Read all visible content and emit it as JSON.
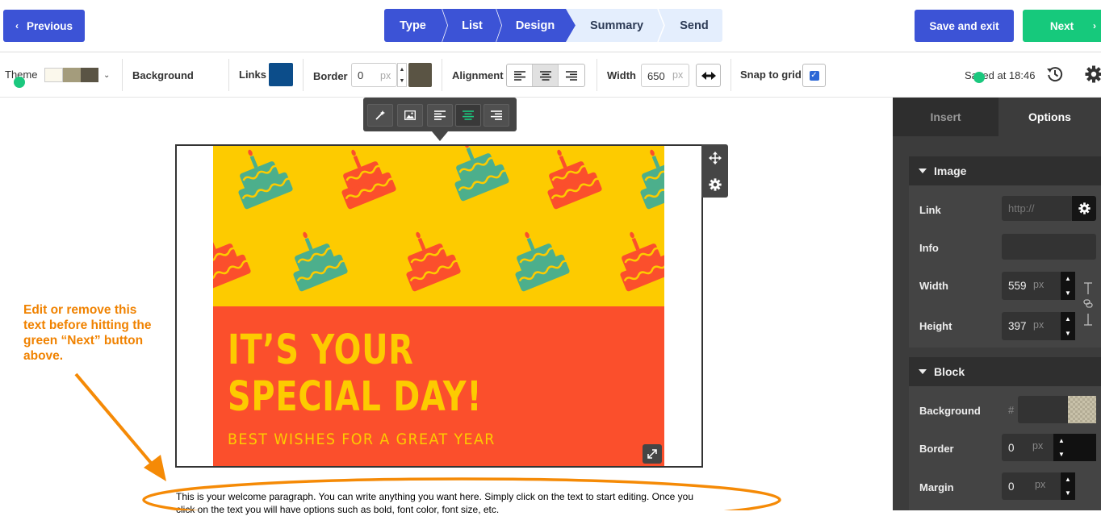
{
  "nav": {
    "previous_label": "Previous",
    "save_exit_label": "Save and exit",
    "next_label": "Next",
    "steps": [
      {
        "label": "Type",
        "state": "done"
      },
      {
        "label": "List",
        "state": "done"
      },
      {
        "label": "Design",
        "state": "done"
      },
      {
        "label": "Summary",
        "state": "todo"
      },
      {
        "label": "Send",
        "state": "todo"
      }
    ],
    "colors": {
      "primary": "#3c53d6",
      "success": "#16c97c",
      "step_pending": "#e4eefd"
    }
  },
  "toolbar": {
    "theme_label": "Theme",
    "theme_colors": [
      "#fbf8ec",
      "#a49c7c",
      "#5a5444"
    ],
    "background_label": "Background",
    "links_label": "Links",
    "links_color": "#0c4d8a",
    "border_label": "Border",
    "border_value": "0",
    "border_unit": "px",
    "border_color": "#5a5444",
    "alignment_label": "Alignment",
    "alignment_selected": "center",
    "width_label": "Width",
    "width_value": "650",
    "width_unit": "px",
    "snap_label": "Snap to grid",
    "snap_checked": true,
    "saved_text": "Saved at 18:46"
  },
  "canvas": {
    "image_toolbar_selected": "align-center",
    "headline": "IT’S YOUR\nSPECIAL DAY!",
    "tagline": "BEST WISHES FOR A GREAT YEAR",
    "art_colors": {
      "yellow": "#fdcb00",
      "red": "#fb4f2c",
      "teal": "#4caf8c"
    },
    "annotation": "Edit or remove this text before hitting the green “Next” button above.",
    "annotation_color": "#f08200",
    "paragraph": "This is your welcome paragraph. You can write anything you want here. Simply click on the text to start editing. Once you click on the text you will have options such as bold, font color, font size, etc."
  },
  "panel": {
    "tabs": [
      {
        "label": "Insert",
        "active": false
      },
      {
        "label": "Options",
        "active": true
      }
    ],
    "image_section": {
      "title": "Image",
      "link_label": "Link",
      "link_placeholder": "http://",
      "info_label": "Info",
      "width_label": "Width",
      "width_value": "559",
      "height_label": "Height",
      "height_value": "397",
      "unit": "px"
    },
    "block_section": {
      "title": "Block",
      "background_label": "Background",
      "background_hash": "#",
      "border_label": "Border",
      "border_value": "0",
      "margin_label": "Margin",
      "margin_value": "0",
      "unit": "px"
    }
  }
}
